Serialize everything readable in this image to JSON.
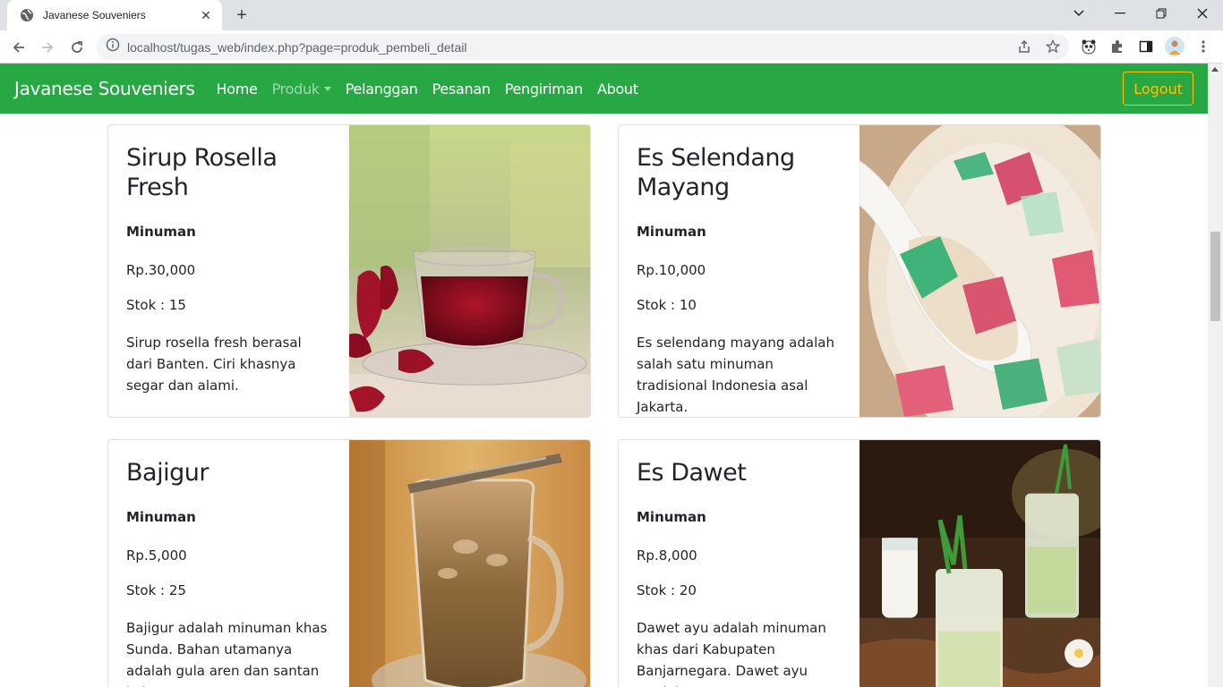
{
  "browser": {
    "tab_title": "Javanese Souveniers",
    "url": "localhost/tugas_web/index.php?page=produk_pembeli_detail"
  },
  "navbar": {
    "brand": "Javanese Souveniers",
    "links": [
      "Home",
      "Produk",
      "Pelanggan",
      "Pesanan",
      "Pengiriman",
      "About"
    ],
    "logout": "Logout"
  },
  "products": [
    {
      "name": "Sirup Rosella Fresh",
      "category": "Minuman",
      "price": "Rp.30,000",
      "stock": "Stok : 15",
      "description": "Sirup rosella fresh berasal dari Banten. Ciri khasnya segar dan alami."
    },
    {
      "name": "Es Selendang Mayang",
      "category": "Minuman",
      "price": "Rp.10,000",
      "stock": "Stok : 10",
      "description": "Es selendang mayang adalah salah satu minuman tradisional Indonesia asal Jakarta."
    },
    {
      "name": "Bajigur",
      "category": "Minuman",
      "price": "Rp.5,000",
      "stock": "Stok : 25",
      "description": "Bajigur adalah minuman khas Sunda. Bahan utamanya adalah gula aren dan santan kelapa"
    },
    {
      "name": "Es Dawet",
      "category": "Minuman",
      "price": "Rp.8,000",
      "stock": "Stok : 20",
      "description": "Dawet ayu adalah minuman khas dari Kabupaten Banjarnegara. Dawet ayu mudah"
    }
  ]
}
